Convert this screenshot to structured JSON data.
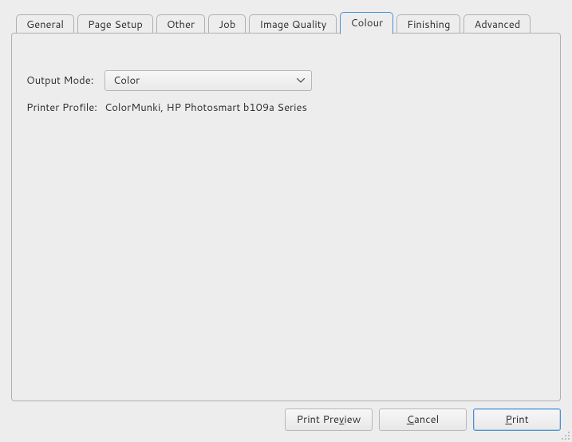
{
  "tabs": [
    {
      "label": "General"
    },
    {
      "label": "Page Setup"
    },
    {
      "label": "Other"
    },
    {
      "label": "Job"
    },
    {
      "label": "Image Quality"
    },
    {
      "label": "Colour"
    },
    {
      "label": "Finishing"
    },
    {
      "label": "Advanced"
    }
  ],
  "active_tab_index": 5,
  "content": {
    "output_mode_label": "Output Mode:",
    "output_mode_value": "Color",
    "printer_profile_label": "Printer Profile:",
    "printer_profile_value": "ColorMunki, HP Photosmart b109a Series"
  },
  "buttons": {
    "preview": {
      "pre": "Print Pre",
      "m": "v",
      "post": "iew"
    },
    "cancel": {
      "pre": "",
      "m": "C",
      "post": "ancel"
    },
    "print": {
      "pre": "",
      "m": "P",
      "post": "rint"
    }
  }
}
